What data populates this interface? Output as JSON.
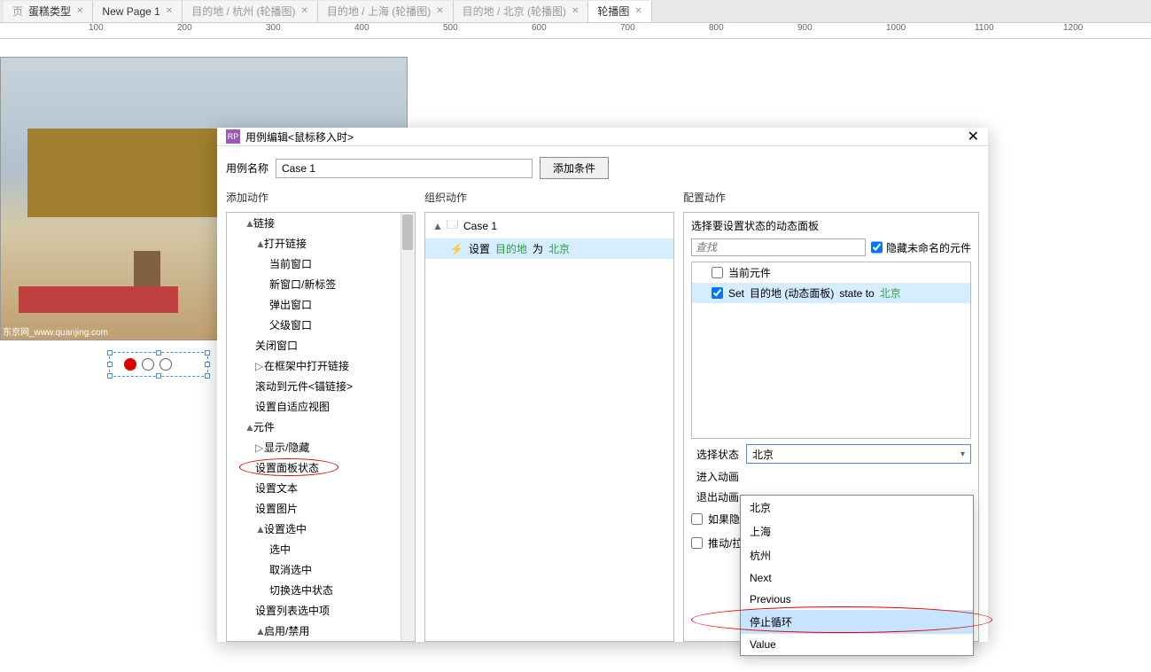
{
  "tabs": [
    {
      "label": "蛋糕类型"
    },
    {
      "label": "New Page 1"
    },
    {
      "label": "目的地 / 杭州 (轮播图)"
    },
    {
      "label": "目的地 / 上海 (轮播图)"
    },
    {
      "label": "目的地 / 北京 (轮播图)"
    },
    {
      "label": "轮播图",
      "active": true
    }
  ],
  "ruler": [
    "100",
    "200",
    "300",
    "400",
    "500",
    "600",
    "700",
    "800",
    "900",
    "1000",
    "1100",
    "1200"
  ],
  "watermark": "东京网_www.quanjing.com",
  "dialog": {
    "title": "用例编辑<鼠标移入时>",
    "caseNameLabel": "用例名称",
    "caseNameValue": "Case 1",
    "addConditionBtn": "添加条件",
    "headers": {
      "addAction": "添加动作",
      "organize": "组织动作",
      "configure": "配置动作"
    },
    "tree": {
      "link": "链接",
      "openLink": "打开链接",
      "openLink_items": [
        "当前窗口",
        "新窗口/新标签",
        "弹出窗口",
        "父级窗口"
      ],
      "closeWindow": "关闭窗口",
      "openInFrame": "在框架中打开链接",
      "scrollTo": "滚动到元件<锚链接>",
      "setAdaptive": "设置自适应视图",
      "widgets": "元件",
      "showHide": "显示/隐藏",
      "setPanelState": "设置面板状态",
      "setText": "设置文本",
      "setImage": "设置图片",
      "setSelected": "设置选中",
      "selected_items": [
        "选中",
        "取消选中",
        "切换选中状态"
      ],
      "setListSelected": "设置列表选中项",
      "enableDisable": "启用/禁用"
    },
    "organize": {
      "caseLabel": "Case 1",
      "actionPrefix": "设置",
      "actionTarget": "目的地",
      "actionMid": "为",
      "actionState": "北京"
    },
    "configure": {
      "selectPanelLabel": "选择要设置状态的动态面板",
      "searchPlaceholder": "查找",
      "hideUnnamed": "隐藏未命名的元件",
      "currentWidget": "当前元件",
      "setRowPrefix": "Set",
      "setRowTarget": "目的地 (动态面板)",
      "setRowMid": "state to",
      "setRowState": "北京",
      "selectStateLabel": "选择状态",
      "selectedState": "北京",
      "enterAnim": "进入动画",
      "exitAnim": "退出动画",
      "ifHidden": "如果隐",
      "pushPull": "推动/拉"
    }
  },
  "dropdown": [
    "北京",
    "上海",
    "杭州",
    "Next",
    "Previous",
    "停止循环",
    "Value"
  ]
}
